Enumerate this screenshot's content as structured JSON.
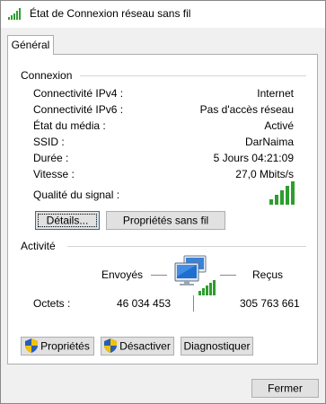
{
  "window": {
    "title": "État de Connexion réseau sans fil"
  },
  "tabs": [
    {
      "label": "Général"
    }
  ],
  "connection": {
    "section_label": "Connexion",
    "rows": [
      {
        "label": "Connectivité IPv4 :",
        "value": "Internet"
      },
      {
        "label": "Connectivité IPv6 :",
        "value": "Pas d'accès réseau"
      },
      {
        "label": "État du média :",
        "value": "Activé"
      },
      {
        "label": "SSID :",
        "value": "DarNaima"
      },
      {
        "label": "Durée :",
        "value": "5 Jours 04:21:09"
      },
      {
        "label": "Vitesse :",
        "value": "27,0 Mbits/s"
      }
    ],
    "signal_label": "Qualité du signal :",
    "signal_bars": 5,
    "details_button": "Détails...",
    "wireless_properties_button": "Propriétés sans fil"
  },
  "activity": {
    "section_label": "Activité",
    "sent_label": "Envoyés",
    "received_label": "Reçus",
    "bytes_label": "Octets :",
    "bytes_sent": "46 034 453",
    "bytes_received": "305 763 661"
  },
  "actions": {
    "properties_button": "Propriétés",
    "disable_button": "Désactiver",
    "diagnose_button": "Diagnostiquer"
  },
  "footer": {
    "close_button": "Fermer"
  },
  "colors": {
    "signal_green": "#2e9d2e",
    "accent_blue": "#0078d7",
    "shield_blue": "#2a5db0",
    "shield_yellow": "#f2c200"
  }
}
